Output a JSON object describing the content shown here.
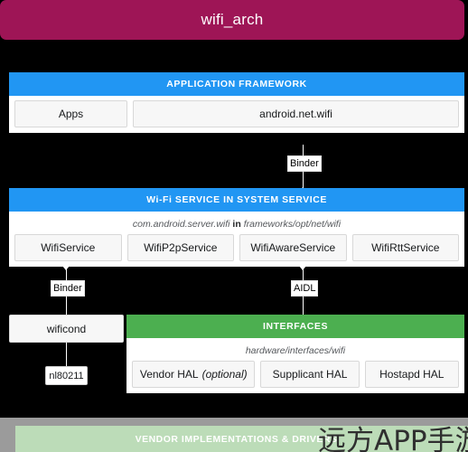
{
  "title_bar": {
    "title": "wifi_arch"
  },
  "layers": {
    "application_framework": {
      "header": "APPLICATION FRAMEWORK",
      "boxes": [
        {
          "label": "Apps"
        },
        {
          "label": "android.net.wifi"
        }
      ]
    },
    "wifi_service": {
      "header": "Wi-Fi SERVICE IN SYSTEM SERVICE",
      "path_prefix": "com.android.server.wifi",
      "path_keyword": "in",
      "path_suffix": "frameworks/opt/net/wifi",
      "boxes": [
        {
          "label": "WifiService"
        },
        {
          "label": "WifiP2pService"
        },
        {
          "label": "WifiAwareService"
        },
        {
          "label": "WifiRttService"
        }
      ]
    },
    "interfaces": {
      "header": "INTERFACES",
      "path": "hardware/interfaces/wifi",
      "boxes": [
        {
          "label": "Vendor HAL",
          "suffix": "(optional)"
        },
        {
          "label": "Supplicant HAL",
          "suffix": ""
        },
        {
          "label": "Hostapd HAL",
          "suffix": ""
        }
      ]
    },
    "vendor": {
      "header": "VENDOR IMPLEMENTATIONS & DRIVERS"
    }
  },
  "connectors": {
    "binder_top": "Binder",
    "binder_left": "Binder",
    "aidl": "AIDL"
  },
  "free_boxes": {
    "wificond": "wificond",
    "nl80211": "nl80211"
  },
  "watermark": {
    "text": "远方APP手游网"
  },
  "colors": {
    "title_bar": "#9e1556",
    "header_blue": "#2196f3",
    "header_green": "#4caf50",
    "vendor_green": "#bcdcb8",
    "vendor_frame": "#9b9b9b",
    "background": "#000000",
    "box_fill": "#f7f7f7",
    "box_border": "#d8d8d8"
  }
}
